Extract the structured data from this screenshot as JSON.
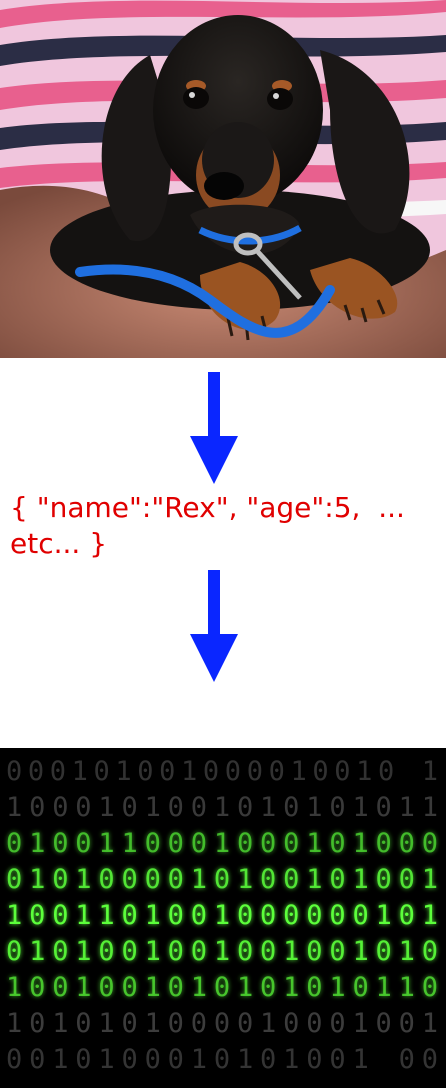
{
  "image": {
    "subject": "dachshund puppy held in a person's arms",
    "icon": "dog-photo"
  },
  "arrows": {
    "color": "#0a26ff",
    "icon": "down-arrow-icon"
  },
  "json_text": {
    "line1": "{ \"name\":\"Rex\", \"age\":5,  ...",
    "line2": "etc... }",
    "color": "#e00000"
  },
  "binary": {
    "rows": [
      "000101001000010010 1",
      "1000101001010101011",
      "0100110001000101000",
      "0101000010100101001",
      "1001101001000000101",
      "0101001001001001010",
      "1001001010101010110",
      "1010101000010001001",
      "0010100010101001 00"
    ],
    "glow_color": "#5bff3a",
    "dim_color": "#6f6f6f"
  }
}
